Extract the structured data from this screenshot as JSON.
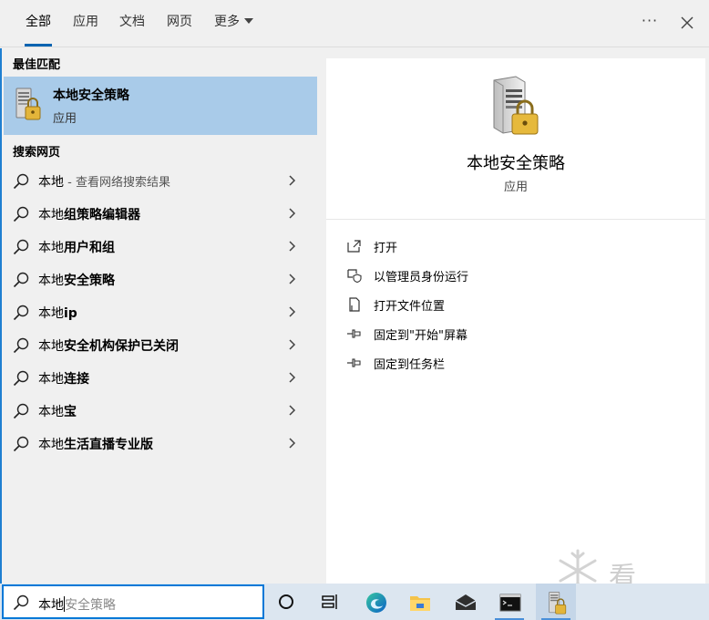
{
  "tabs": [
    {
      "label": "全部",
      "active": true
    },
    {
      "label": "应用",
      "active": false
    },
    {
      "label": "文档",
      "active": false
    },
    {
      "label": "网页",
      "active": false
    },
    {
      "label": "更多",
      "active": false
    }
  ],
  "header": {
    "more_glyph": "···"
  },
  "best_match": {
    "section_title": "最佳匹配",
    "name": "本地安全策略",
    "type": "应用"
  },
  "web": {
    "section_title": "搜索网页",
    "items": [
      {
        "prefix": "本地",
        "bold": "",
        "hint": " - 查看网络搜索结果"
      },
      {
        "prefix": "本地",
        "bold": "组策略编辑器",
        "hint": ""
      },
      {
        "prefix": "本地",
        "bold": "用户和组",
        "hint": ""
      },
      {
        "prefix": "本地",
        "bold": "安全策略",
        "hint": ""
      },
      {
        "prefix": "本地",
        "bold": "ip",
        "hint": ""
      },
      {
        "prefix": "本地",
        "bold": "安全机构保护已关闭",
        "hint": ""
      },
      {
        "prefix": "本地",
        "bold": "连接",
        "hint": ""
      },
      {
        "prefix": "本地",
        "bold": "宝",
        "hint": ""
      },
      {
        "prefix": "本地",
        "bold": "生活直播专业版",
        "hint": ""
      }
    ]
  },
  "detail": {
    "name": "本地安全策略",
    "type": "应用",
    "actions": [
      {
        "label": "打开",
        "icon": "open-icon"
      },
      {
        "label": "以管理员身份运行",
        "icon": "shield-icon"
      },
      {
        "label": "打开文件位置",
        "icon": "file-location-icon"
      },
      {
        "label": "固定到\"开始\"屏幕",
        "icon": "pin-icon"
      },
      {
        "label": "固定到任务栏",
        "icon": "pin-icon"
      }
    ]
  },
  "search": {
    "typed": "本地",
    "suggestion": "安全策略"
  },
  "watermark": {
    "text": "看雪"
  },
  "colors": {
    "accent": "#0063b1",
    "selected_bg": "#a9cbe9",
    "panel_bg": "#f0f0f0",
    "taskbar_bg": "#dce6f0"
  }
}
